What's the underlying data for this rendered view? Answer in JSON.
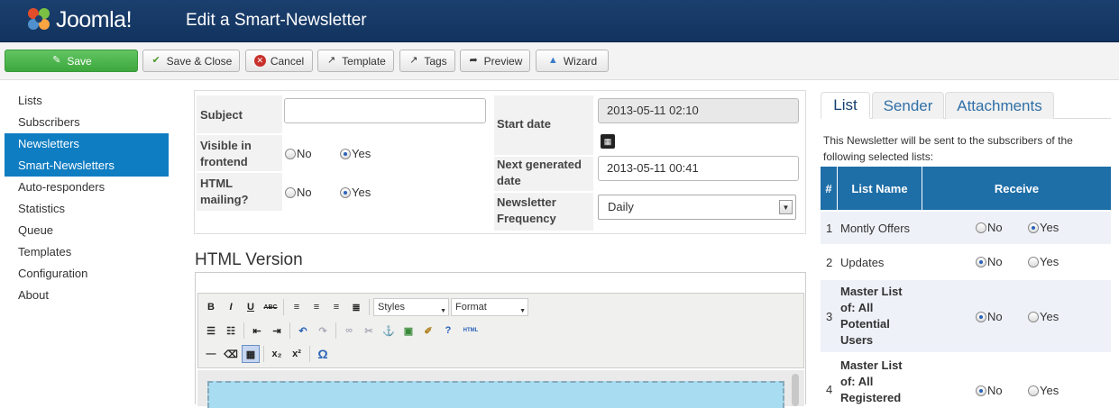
{
  "header": {
    "logo_text": "Joomla!",
    "title": "Edit a Smart-Newsletter",
    "brand_colors": [
      "#1b3f6e",
      "#e14d2a",
      "#7ac143",
      "#f9a541",
      "#5091cd"
    ]
  },
  "toolbar": {
    "save": "Save",
    "save_close": "Save & Close",
    "cancel": "Cancel",
    "template": "Template",
    "tags": "Tags",
    "preview": "Preview",
    "wizard": "Wizard"
  },
  "sidebar": {
    "items": [
      {
        "label": "Lists"
      },
      {
        "label": "Subscribers"
      },
      {
        "label": "Newsletters"
      },
      {
        "label": "Smart-Newsletters"
      },
      {
        "label": "Auto-responders"
      },
      {
        "label": "Statistics"
      },
      {
        "label": "Queue"
      },
      {
        "label": "Templates"
      },
      {
        "label": "Configuration"
      },
      {
        "label": "About"
      }
    ],
    "active_color": "#0f7dc2"
  },
  "form": {
    "subject_label": "Subject",
    "subject_value": "",
    "visible_label": "Visible in frontend",
    "visible_no": "No",
    "visible_yes": "Yes",
    "visible_selected": "Yes",
    "html_label": "HTML mailing?",
    "html_no": "No",
    "html_yes": "Yes",
    "html_selected": "Yes",
    "start_label": "Start date",
    "start_value": "2013-05-11 02:10",
    "next_label": "Next generated date",
    "next_value": "2013-05-11 00:41",
    "freq_label": "Newsletter Frequency",
    "freq_value": "Daily"
  },
  "editor": {
    "section_title": "HTML Version",
    "styles": "Styles",
    "format": "Format",
    "html_btn": "HTML"
  },
  "right": {
    "tabs": [
      "List",
      "Sender",
      "Attachments"
    ],
    "active_tab": "List",
    "description": "This Newsletter will be sent to the subscribers of the following selected lists:",
    "headers": {
      "num": "#",
      "name": "List Name",
      "receive": "Receive"
    },
    "rows": [
      {
        "num": "1",
        "name": "Montly Offers",
        "no": "No",
        "yes": "Yes",
        "selected": "Yes"
      },
      {
        "num": "2",
        "name": "Updates",
        "no": "No",
        "yes": "Yes",
        "selected": "No"
      },
      {
        "num": "3",
        "name": "Master List of: All Potential Users",
        "no": "No",
        "yes": "Yes",
        "selected": "No"
      },
      {
        "num": "4",
        "name": "Master List of: All Registered",
        "no": "No",
        "yes": "Yes",
        "selected": "No"
      }
    ],
    "header_color": "#1e6ea7"
  }
}
